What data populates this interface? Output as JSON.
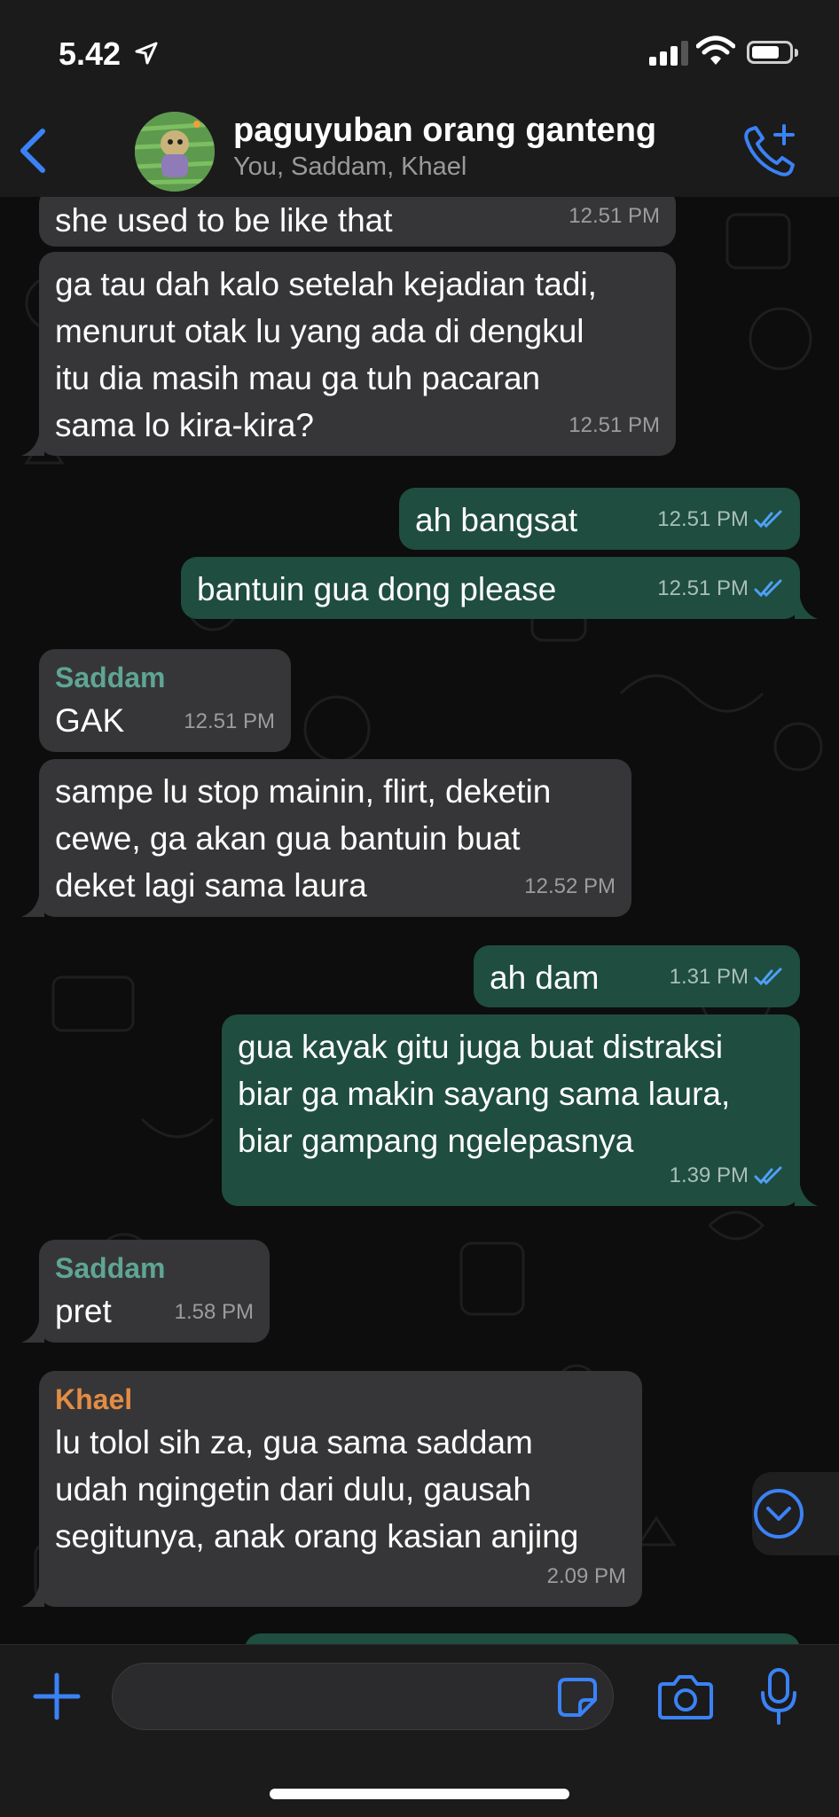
{
  "status_bar": {
    "time": "5.42"
  },
  "header": {
    "title": "paguyuban orang ganteng",
    "subtitle": "You, Saddam, Khael"
  },
  "messages": [
    {
      "direction": "in",
      "lines": [
        "she used to be like that"
      ],
      "time": "12.51 PM"
    },
    {
      "direction": "in",
      "lines": [
        "ga tau dah kalo setelah kejadian tadi,",
        "menurut otak lu yang ada di dengkul",
        "itu dia masih mau ga tuh pacaran",
        "sama lo kira-kira?"
      ],
      "time": "12.51 PM"
    },
    {
      "direction": "out",
      "lines": [
        "ah bangsat"
      ],
      "time": "12.51 PM"
    },
    {
      "direction": "out",
      "lines": [
        "bantuin gua dong please"
      ],
      "time": "12.51 PM"
    },
    {
      "direction": "in",
      "sender": "Saddam",
      "lines": [
        "GAK"
      ],
      "time": "12.51 PM"
    },
    {
      "direction": "in",
      "lines": [
        "sampe lu stop mainin, flirt, deketin",
        "cewe, ga akan gua bantuin buat",
        "deket lagi sama laura"
      ],
      "time": "12.52 PM"
    },
    {
      "direction": "out",
      "lines": [
        "ah dam"
      ],
      "time": "1.31 PM"
    },
    {
      "direction": "out",
      "lines": [
        "gua kayak gitu juga buat distraksi",
        "biar ga makin sayang sama laura,",
        "biar gampang ngelepasnya"
      ],
      "time": "1.39 PM"
    },
    {
      "direction": "in",
      "sender": "Saddam",
      "lines": [
        "pret"
      ],
      "time": "1.58 PM"
    },
    {
      "direction": "in",
      "sender": "Khael",
      "lines": [
        "lu tolol sih za, gua sama saddam",
        "udah ngingetin dari dulu, gausah",
        "segitunya, anak orang kasian anjing"
      ],
      "time": "2.09 PM"
    }
  ],
  "input": {
    "placeholder": ""
  },
  "icons": {
    "back": "chevron-left-icon",
    "call": "add-call-icon",
    "plus": "plus-icon",
    "sticker": "sticker-icon",
    "camera": "camera-icon",
    "mic": "microphone-icon",
    "scroll": "chevron-down-circle-icon",
    "read_receipt": "double-check-icon"
  },
  "colors": {
    "accent": "#3b82f6",
    "incoming_bubble": "#363638",
    "outgoing_bubble": "#1f4d3f",
    "saddam_name": "#5fa593",
    "khael_name": "#e38c44",
    "read_tick": "#4ea0f5"
  }
}
